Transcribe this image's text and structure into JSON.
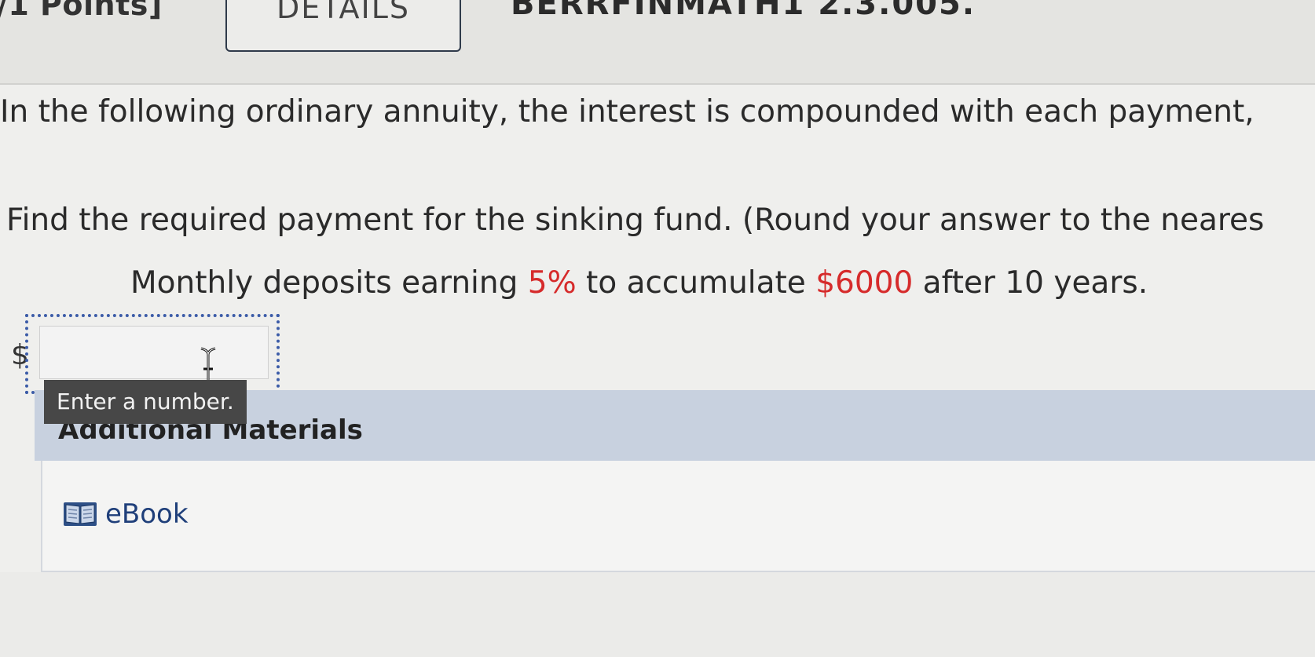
{
  "header": {
    "points": "/1 Points]",
    "details_label": "DETAILS",
    "question_id": "BERRFINMATH1 2.3.005."
  },
  "question": {
    "intro": "In the following ordinary annuity, the interest is compounded with each payment,",
    "instruction": "Find the required payment for the sinking fund. (Round your answer to the neares",
    "problem": {
      "part1": "Monthly deposits earning ",
      "rate": "5%",
      "part2": " to accumulate ",
      "amount": "$6000",
      "part3": " after 10 years."
    }
  },
  "answer": {
    "currency_symbol": "$",
    "value": "",
    "tooltip": "Enter a number."
  },
  "materials": {
    "title": "Additional Materials",
    "ebook_label": "eBook",
    "ebook_icon": "book-icon"
  },
  "colors": {
    "highlight_red": "#d62b2b",
    "focus_border": "#3c5ca8",
    "materials_header_bg": "#c8d1df",
    "link_blue": "#1f3f7a"
  }
}
